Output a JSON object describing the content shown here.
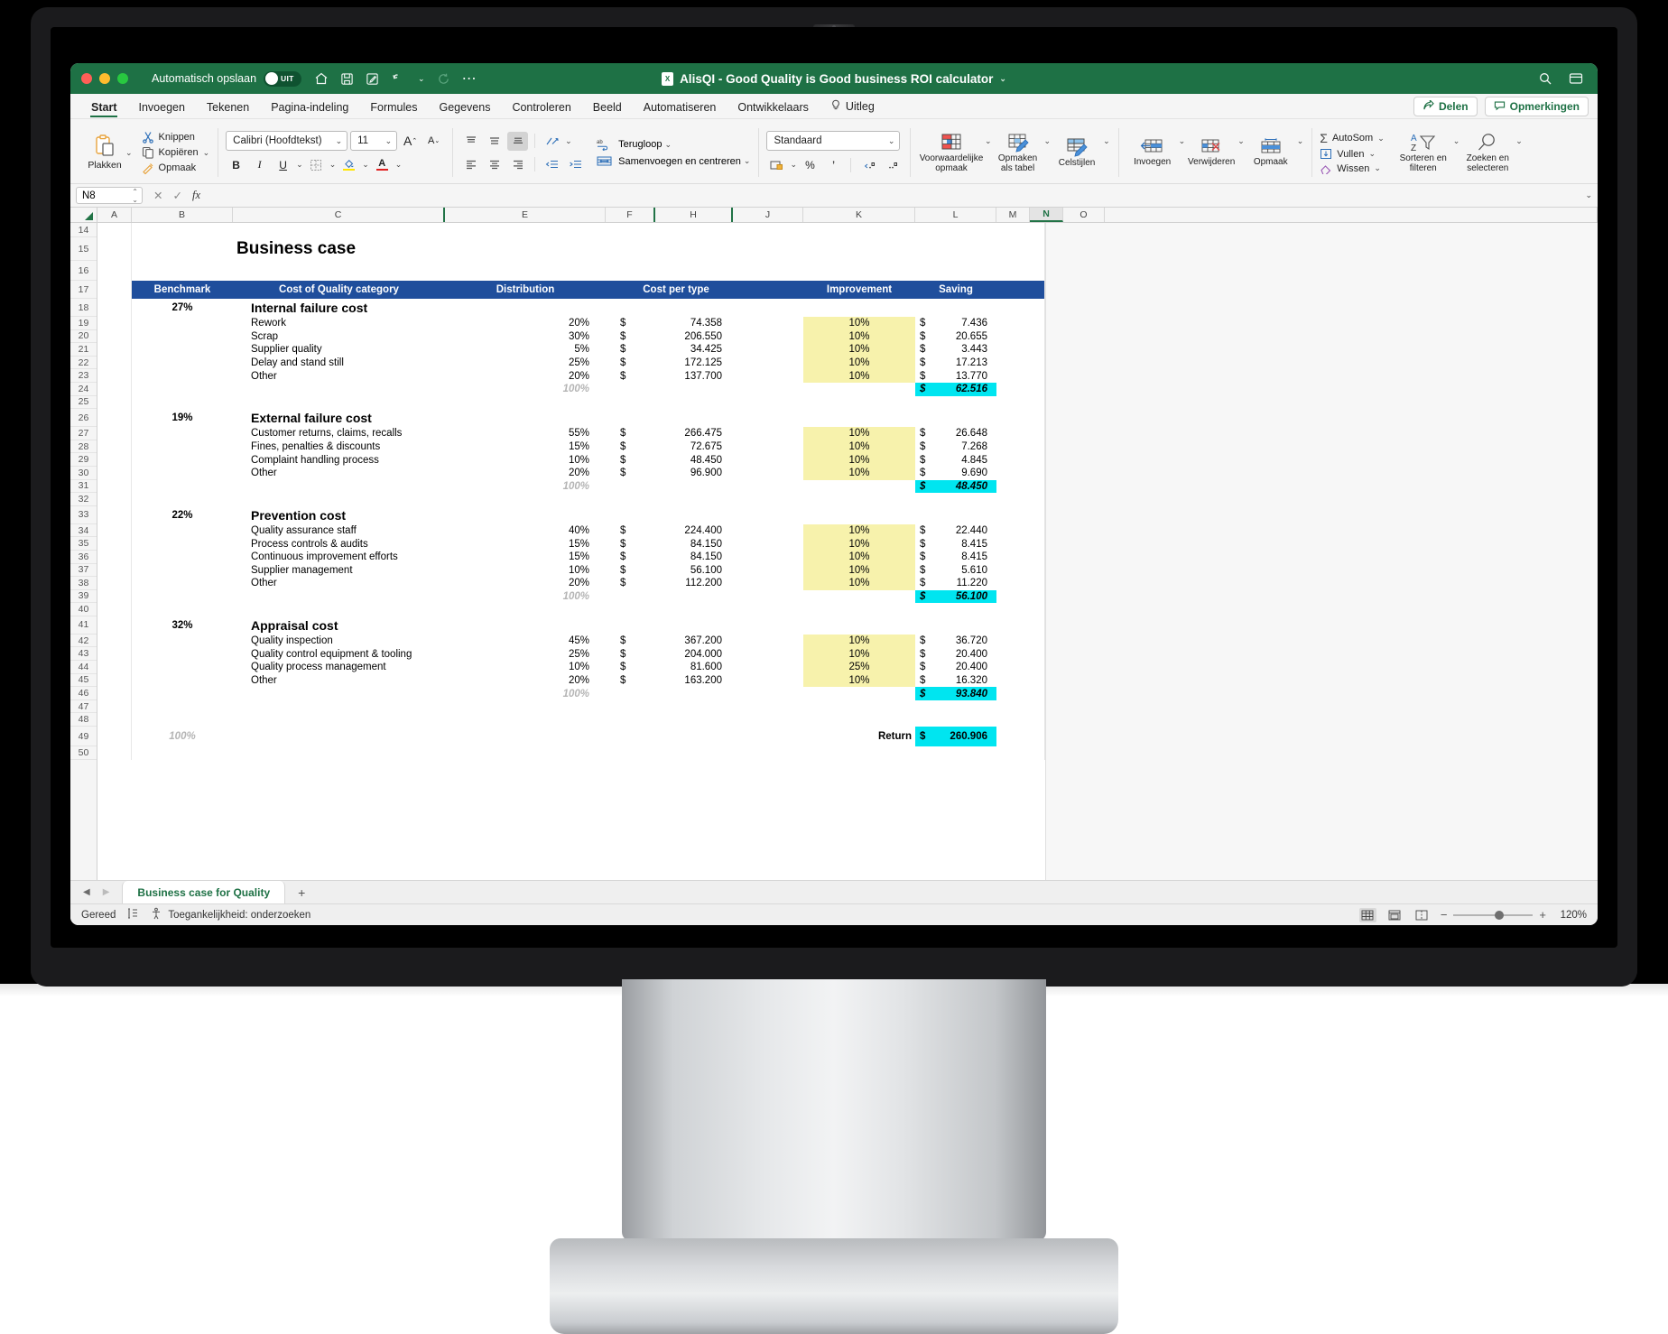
{
  "window": {
    "autosave_label": "Automatisch opslaan",
    "autosave_state": "UIT",
    "document_title": "AlisQI - Good Quality is Good business ROI calculator",
    "title_green": "#1e7145"
  },
  "tabs": [
    {
      "label": "Start",
      "active": true
    },
    {
      "label": "Invoegen",
      "active": false
    },
    {
      "label": "Tekenen",
      "active": false
    },
    {
      "label": "Pagina-indeling",
      "active": false
    },
    {
      "label": "Formules",
      "active": false
    },
    {
      "label": "Gegevens",
      "active": false
    },
    {
      "label": "Controleren",
      "active": false
    },
    {
      "label": "Beeld",
      "active": false
    },
    {
      "label": "Automatiseren",
      "active": false
    },
    {
      "label": "Ontwikkelaars",
      "active": false
    },
    {
      "label": "Uitleg",
      "active": false
    }
  ],
  "tab_actions": {
    "share": "Delen",
    "comments": "Opmerkingen"
  },
  "ribbon": {
    "paste": "Plakken",
    "cut": "Knippen",
    "copy": "Kopiëren",
    "format_painter": "Opmaak",
    "font_name": "Calibri (Hoofdtekst)",
    "font_size": "11",
    "bold": "B",
    "italic": "I",
    "underline": "U",
    "wrap_text": "Terugloop",
    "merge_center": "Samenvoegen en centreren",
    "number_format": "Standaard",
    "percent": "%",
    "conditional_formatting": "Voorwaardelijke opmaak",
    "format_as_table": "Opmaken als tabel",
    "cell_styles": "Celstijlen",
    "insert": "Invoegen",
    "delete": "Verwijderen",
    "format": "Opmaak",
    "autosum": "AutoSom",
    "fill": "Vullen",
    "clear": "Wissen",
    "sort_filter": "Sorteren en filteren",
    "find_select": "Zoeken en selecteren"
  },
  "formula_bar": {
    "name_box": "N8",
    "formula": ""
  },
  "grid": {
    "columns": [
      "A",
      "B",
      "C",
      "E",
      "F",
      "H",
      "J",
      "K",
      "L",
      "M",
      "N",
      "O"
    ],
    "selected_column": "N",
    "rows": [
      14,
      15,
      16,
      17,
      18,
      19,
      20,
      21,
      22,
      23,
      24,
      25,
      26,
      27,
      28,
      29,
      30,
      31,
      32,
      33,
      34,
      35,
      36,
      37,
      38,
      39,
      40,
      41,
      42,
      43,
      44,
      45,
      46,
      47,
      48,
      49,
      50
    ]
  },
  "sheet_content": {
    "title": "Business case",
    "headers": {
      "benchmark": "Benchmark",
      "category": "Cost of Quality category",
      "distribution": "Distribution",
      "cost_per_type": "Cost per type",
      "improvement": "Improvement",
      "saving": "Saving"
    },
    "currency_symbol": "$",
    "total_row_label": "Return",
    "grand_total": "260.906",
    "grand_total_distribution": "100%",
    "sections": [
      {
        "benchmark": "27%",
        "name": "Internal failure cost",
        "rows": [
          {
            "label": "Rework",
            "distribution": "20%",
            "cost": "74.358",
            "improvement": "10%",
            "saving": "7.436"
          },
          {
            "label": "Scrap",
            "distribution": "30%",
            "cost": "206.550",
            "improvement": "10%",
            "saving": "20.655"
          },
          {
            "label": "Supplier quality",
            "distribution": "5%",
            "cost": "34.425",
            "improvement": "10%",
            "saving": "3.443"
          },
          {
            "label": "Delay and stand still",
            "distribution": "25%",
            "cost": "172.125",
            "improvement": "10%",
            "saving": "17.213"
          },
          {
            "label": "Other",
            "distribution": "20%",
            "cost": "137.700",
            "improvement": "10%",
            "saving": "13.770"
          }
        ],
        "total_distribution": "100%",
        "subtotal": "62.516"
      },
      {
        "benchmark": "19%",
        "name": "External failure cost",
        "rows": [
          {
            "label": "Customer returns, claims, recalls",
            "distribution": "55%",
            "cost": "266.475",
            "improvement": "10%",
            "saving": "26.648"
          },
          {
            "label": "Fines, penalties & discounts",
            "distribution": "15%",
            "cost": "72.675",
            "improvement": "10%",
            "saving": "7.268"
          },
          {
            "label": "Complaint handling process",
            "distribution": "10%",
            "cost": "48.450",
            "improvement": "10%",
            "saving": "4.845"
          },
          {
            "label": "Other",
            "distribution": "20%",
            "cost": "96.900",
            "improvement": "10%",
            "saving": "9.690"
          }
        ],
        "total_distribution": "100%",
        "subtotal": "48.450"
      },
      {
        "benchmark": "22%",
        "name": "Prevention cost",
        "rows": [
          {
            "label": "Quality assurance staff",
            "distribution": "40%",
            "cost": "224.400",
            "improvement": "10%",
            "saving": "22.440"
          },
          {
            "label": "Process controls & audits",
            "distribution": "15%",
            "cost": "84.150",
            "improvement": "10%",
            "saving": "8.415"
          },
          {
            "label": "Continuous improvement efforts",
            "distribution": "15%",
            "cost": "84.150",
            "improvement": "10%",
            "saving": "8.415"
          },
          {
            "label": "Supplier management",
            "distribution": "10%",
            "cost": "56.100",
            "improvement": "10%",
            "saving": "5.610"
          },
          {
            "label": "Other",
            "distribution": "20%",
            "cost": "112.200",
            "improvement": "10%",
            "saving": "11.220"
          }
        ],
        "total_distribution": "100%",
        "subtotal": "56.100"
      },
      {
        "benchmark": "32%",
        "name": "Appraisal cost",
        "rows": [
          {
            "label": "Quality inspection",
            "distribution": "45%",
            "cost": "367.200",
            "improvement": "10%",
            "saving": "36.720"
          },
          {
            "label": "Quality control equipment & tooling",
            "distribution": "25%",
            "cost": "204.000",
            "improvement": "10%",
            "saving": "20.400"
          },
          {
            "label": "Quality process management",
            "distribution": "10%",
            "cost": "81.600",
            "improvement": "25%",
            "saving": "20.400"
          },
          {
            "label": "Other",
            "distribution": "20%",
            "cost": "163.200",
            "improvement": "10%",
            "saving": "16.320"
          }
        ],
        "total_distribution": "100%",
        "subtotal": "93.840"
      }
    ]
  },
  "sheet_tabs": {
    "active": "Business case for Quality",
    "add": "+"
  },
  "status": {
    "ready": "Gereed",
    "accessibility": "Toegankelijkheid: onderzoeken",
    "zoom": "120%",
    "zoom_out": "−",
    "zoom_in": "+"
  },
  "colors": {
    "header_blue": "#1f4e9c",
    "highlight_yellow": "#f7f2ac",
    "total_cyan": "#00e5f0",
    "excel_green": "#1e7145"
  }
}
